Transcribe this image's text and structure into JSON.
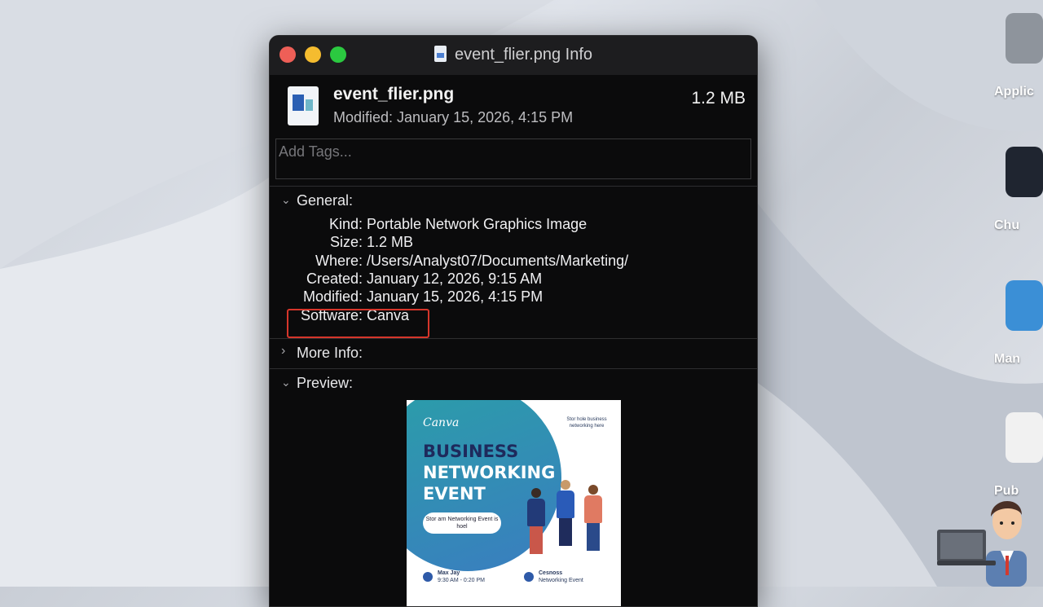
{
  "window": {
    "title": "event_flier.png Info"
  },
  "file": {
    "name": "event_flier.png",
    "modified_line": "Modified: January 15, 2026, 4:15 PM",
    "size": "1.2 MB"
  },
  "tags": {
    "placeholder": "Add Tags..."
  },
  "general": {
    "title": "General:",
    "rows": [
      {
        "label": "Kind:",
        "value": "Portable Network Graphics Image"
      },
      {
        "label": "Size:",
        "value": "1.2 MB"
      },
      {
        "label": "Where:",
        "value": "/Users/Analyst07/Documents/Marketing/"
      },
      {
        "label": "Created:",
        "value": "January 12, 2026, 9:15 AM"
      },
      {
        "label": "Modified:",
        "value": "January 15, 2026, 4:15 PM"
      },
      {
        "label": "Software:",
        "value": "Canva"
      }
    ]
  },
  "more_info": {
    "title": "More Info:"
  },
  "preview": {
    "title": "Preview:",
    "flier": {
      "brand": "Canva",
      "headline_1": "BUSINESS",
      "headline_2": "NETWORKING",
      "headline_3": "EVENT",
      "tagline": "Stor hole business networking here",
      "button_text": "Stor arn Networking Event is hoel",
      "info_1_title": "Max Jay",
      "info_1_sub": "9:30 AM - 0:20 PM",
      "info_2_title": "Cesnoss",
      "info_2_sub": "Networking Event"
    }
  },
  "desktop": {
    "icons": [
      {
        "label": "Applic"
      },
      {
        "label": "Chu"
      },
      {
        "label": "Man"
      },
      {
        "label": "Pub"
      }
    ]
  },
  "colors": {
    "highlight": "#d6362b",
    "close": "#ee5f57",
    "minimize": "#f5bc2f",
    "zoom": "#2bc940"
  }
}
